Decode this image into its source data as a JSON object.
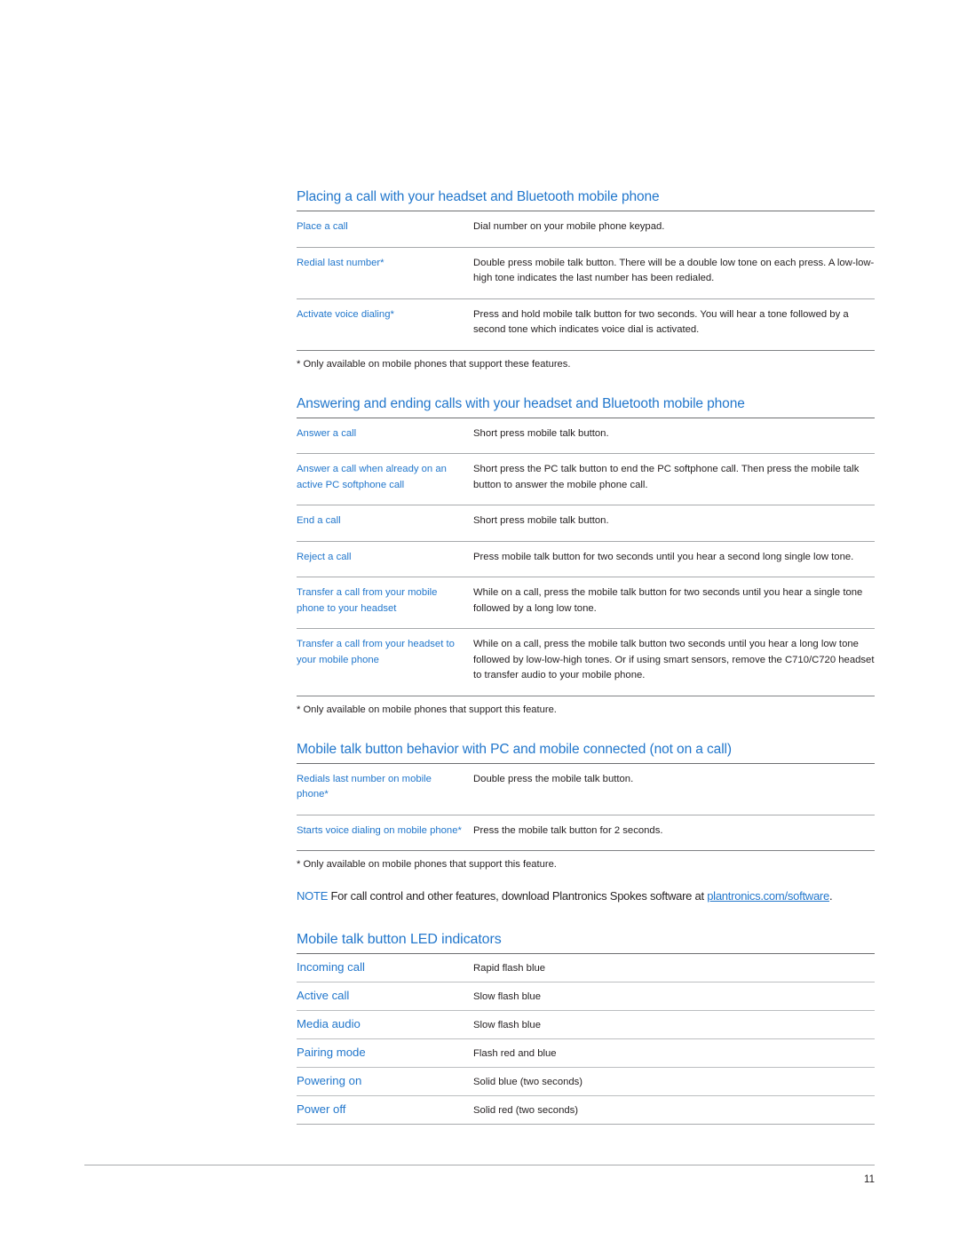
{
  "document": {
    "page_number": "11"
  },
  "sections": [
    {
      "id": "placing-a-call",
      "heading": "Placing a call with your headset and Bluetooth mobile phone",
      "rows": [
        {
          "label": "Place a call",
          "value": "Dial number on your mobile phone keypad."
        },
        {
          "label": "Redial last number*",
          "value": "Double press mobile talk button. There will be a double low tone on each press. A low-low-high tone indicates the last number has been redialed."
        },
        {
          "label": "Activate voice dialing*",
          "value": "Press and hold mobile talk button for two seconds. You will hear a tone followed by a second tone which indicates voice dial is activated."
        }
      ],
      "footnote": "* Only available on mobile phones that support these features."
    },
    {
      "id": "answering-ending-calls",
      "heading": "Answering and ending calls with your headset and Bluetooth mobile phone",
      "rows": [
        {
          "label": "Answer a call",
          "value": "Short press mobile talk button."
        },
        {
          "label": "Answer a call when already on an active PC softphone call",
          "value": "Short press the PC talk button to end the PC softphone call. Then press the mobile talk button to answer the mobile phone call."
        },
        {
          "label": "End a call",
          "value": "Short press mobile talk button."
        },
        {
          "label": "Reject a call",
          "value": "Press mobile talk button for two seconds until you hear a second long single low tone."
        },
        {
          "label": "Transfer a call from your mobile phone to your headset",
          "value": "While on a call, press the mobile talk button for two seconds until you hear a single tone followed by a long low tone."
        },
        {
          "label": "Transfer a call from your headset to your mobile phone",
          "value": "While on a call, press the mobile talk button two seconds until you hear a long low tone followed by low-low-high tones. Or if using smart sensors, remove the C710/C720 headset to transfer audio to your mobile phone."
        }
      ],
      "footnote": "* Only available on mobile phones that support this feature."
    },
    {
      "id": "mobile-talk-button-behavior",
      "heading": "Mobile talk button behavior with PC and mobile connected (not on a call)",
      "rows": [
        {
          "label": "Redials last number on mobile phone*",
          "value": "Double press the mobile talk button."
        },
        {
          "label": "Starts voice dialing on mobile phone*",
          "value": "Press the mobile talk button for 2 seconds."
        }
      ],
      "footnote": "* Only available on mobile phones that support this feature."
    }
  ],
  "note": {
    "tag": "NOTE",
    "text": " For call control and other features, download Plantronics Spokes software at ",
    "link": "plantronics.com/software",
    "trailing": "."
  },
  "led_section": {
    "id": "led-indicators",
    "heading": "Mobile talk button LED indicators",
    "rows": [
      {
        "label": "Incoming call",
        "value": "Rapid flash blue"
      },
      {
        "label": "Active call",
        "value": "Slow flash blue"
      },
      {
        "label": "Media audio",
        "value": "Slow flash blue"
      },
      {
        "label": "Pairing mode",
        "value": "Flash red and blue"
      },
      {
        "label": "Powering on",
        "value": "Solid blue (two seconds)"
      },
      {
        "label": "Power off",
        "value": "Solid red (two seconds)"
      }
    ]
  },
  "colors": {
    "accent_blue": "#2277cc",
    "body_text": "#231f20",
    "rule_light": "#a7a9ac",
    "rule_dark": "#6d6e71"
  }
}
